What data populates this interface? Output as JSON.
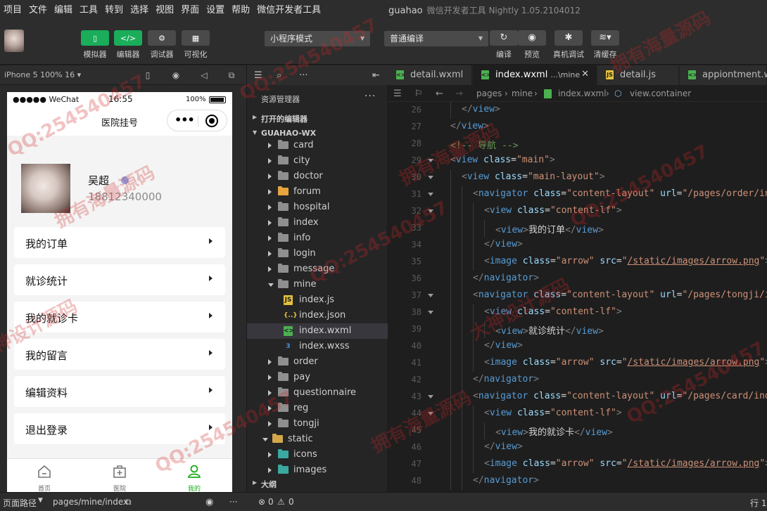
{
  "menubar": {
    "items": [
      "项目",
      "文件",
      "编辑",
      "工具",
      "转到",
      "选择",
      "视图",
      "界面",
      "设置",
      "帮助",
      "微信开发者工具"
    ],
    "project": "guahao",
    "app_title": "微信开发者工具 Nightly 1.05.2104012"
  },
  "toolbar": {
    "simulator": "模拟器",
    "editor": "编辑器",
    "debugger": "调试器",
    "visualize": "可视化",
    "mode_select": "小程序模式",
    "compile_select": "普通编译",
    "compile": "编译",
    "preview": "预览",
    "real_debug": "真机调试",
    "clear_cache": "清缓存",
    "colors": {
      "green": "#1aad5a",
      "button": "#4a4a4a"
    }
  },
  "simulator": {
    "device": "iPhone 5 100% 16",
    "status": {
      "carrier": "●●●●● WeChat",
      "time": "16:55",
      "battery": "100%"
    },
    "nav_title": "医院挂号",
    "profile": {
      "name": "吴超",
      "phone": "18812340000"
    },
    "menu": [
      "我的订单",
      "就诊统计",
      "我的就诊卡",
      "我的留言",
      "编辑资料",
      "退出登录"
    ],
    "tabs": [
      {
        "label": "首页",
        "icon": "home-icon"
      },
      {
        "label": "医院",
        "icon": "hospital-icon"
      },
      {
        "label": "我的",
        "icon": "user-icon"
      }
    ],
    "active_tab_color": "#1aad19"
  },
  "explorer": {
    "title": "资源管理器",
    "open_editors": "打开的编辑器",
    "root": "GUAHAO-WX",
    "folders_top": [
      "card",
      "city",
      "doctor",
      "forum",
      "hospital",
      "index",
      "info",
      "login",
      "message",
      "mine"
    ],
    "mine_files": [
      "index.js",
      "index.json",
      "index.wxml",
      "index.wxss"
    ],
    "folders_bottom": [
      "order",
      "pay",
      "questionnaire",
      "reg",
      "tongji"
    ],
    "static": "static",
    "static_children": [
      "icons",
      "images"
    ],
    "outline": "大纲"
  },
  "editor": {
    "tabs": [
      {
        "label": "detail.wxml",
        "icon": "wxml-file-icon"
      },
      {
        "label": "index.wxml",
        "suffix": "...\\mine",
        "icon": "wxml-file-icon"
      },
      {
        "label": "detail.js",
        "icon": "js-file-icon"
      },
      {
        "label": "appiontment.wx",
        "icon": "wxml-file-icon"
      }
    ],
    "breadcrumb": [
      "pages",
      "mine",
      "index.wxml",
      "view.container"
    ],
    "lines": [
      {
        "n": "26",
        "indent": 1,
        "text": "</view>"
      },
      {
        "n": "27",
        "indent": 0,
        "text": "</view>"
      },
      {
        "n": "28",
        "indent": 0,
        "text": "<!-- 导航 -->"
      },
      {
        "n": "29",
        "indent": 0,
        "text": "<view class=\"main\">"
      },
      {
        "n": "30",
        "indent": 1,
        "text": "<view class=\"main-layout\">"
      },
      {
        "n": "31",
        "indent": 2,
        "text": "<navigator class=\"content-layout\" url=\"/pages/order/ind"
      },
      {
        "n": "32",
        "indent": 3,
        "text": "<view class=\"content-lf\">"
      },
      {
        "n": "33",
        "indent": 4,
        "text": "<view>我的订单</view>"
      },
      {
        "n": "34",
        "indent": 3,
        "text": "</view>"
      },
      {
        "n": "35",
        "indent": 3,
        "text": "<image class=\"arrow\" src=\"/static/images/arrow.png\"><"
      },
      {
        "n": "36",
        "indent": 2,
        "text": "</navigator>"
      },
      {
        "n": "37",
        "indent": 2,
        "text": "<navigator class=\"content-layout\" url=\"/pages/tongji/in"
      },
      {
        "n": "38",
        "indent": 3,
        "text": "<view class=\"content-lf\">"
      },
      {
        "n": "39",
        "indent": 4,
        "text": "<view>就诊统计</view>"
      },
      {
        "n": "40",
        "indent": 3,
        "text": "</view>"
      },
      {
        "n": "41",
        "indent": 3,
        "text": "<image class=\"arrow\" src=\"/static/images/arrow.png\"><"
      },
      {
        "n": "42",
        "indent": 2,
        "text": "</navigator>"
      },
      {
        "n": "43",
        "indent": 2,
        "text": "<navigator class=\"content-layout\" url=\"/pages/card/inde"
      },
      {
        "n": "44",
        "indent": 3,
        "text": "<view class=\"content-lf\">"
      },
      {
        "n": "45",
        "indent": 4,
        "text": "<view>我的就诊卡</view>"
      },
      {
        "n": "46",
        "indent": 3,
        "text": "</view>"
      },
      {
        "n": "47",
        "indent": 3,
        "text": "<image class=\"arrow\" src=\"/static/images/arrow.png\"><"
      },
      {
        "n": "48",
        "indent": 2,
        "text": "</navigator>"
      }
    ]
  },
  "statusbar": {
    "page_path_label": "页面路径",
    "page_path": "pages/mine/index",
    "errors": "0",
    "warnings": "0",
    "line": "行 1"
  },
  "watermark": [
    "QQ:254540457",
    "拥有海量源码",
    "大神设计源码"
  ]
}
